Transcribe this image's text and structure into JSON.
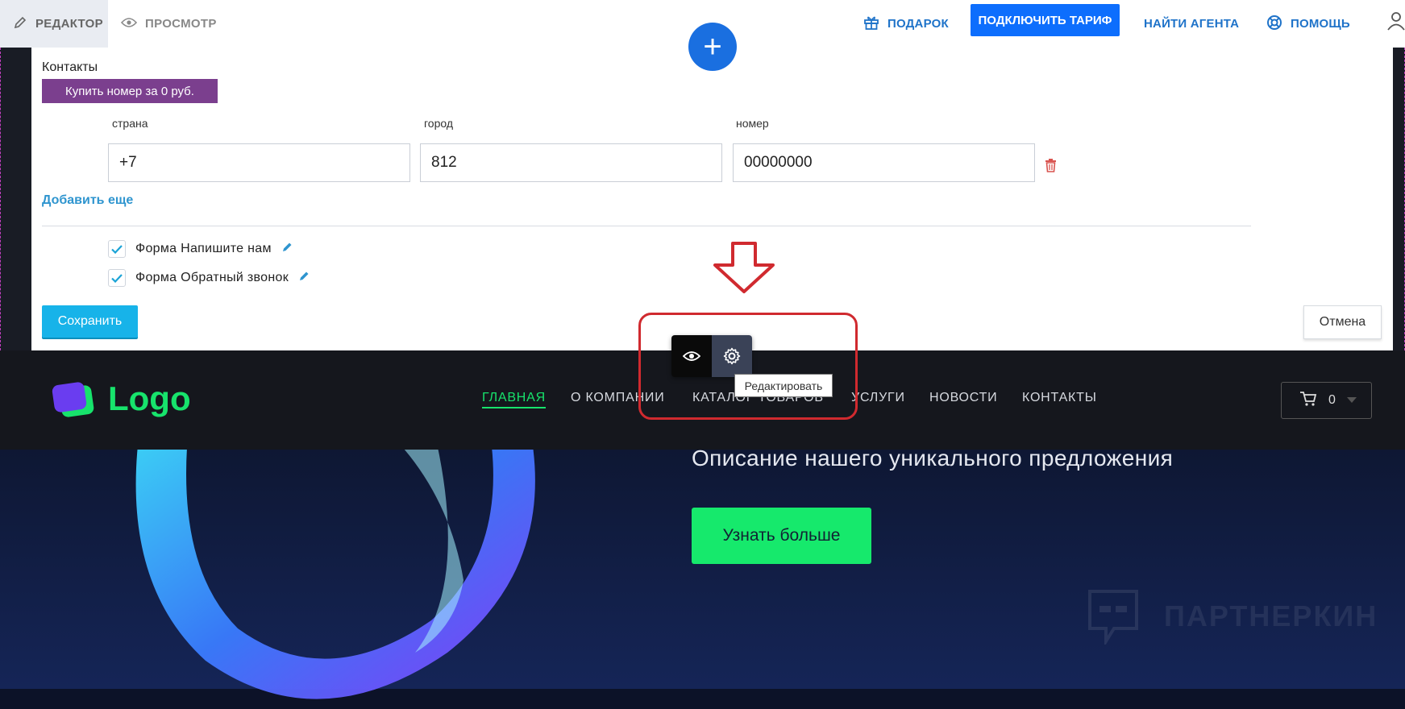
{
  "topbar": {
    "tab_editor": "РЕДАКТОР",
    "tab_preview": "ПРОСМОТР",
    "gift": "ПОДАРОК",
    "connect_tariff": "ПОДКЛЮЧИТЬ ТАРИФ",
    "find_agent": "НАЙТИ АГЕНТА",
    "help": "ПОМОЩЬ"
  },
  "contacts_panel": {
    "title": "Контакты",
    "buy_number": "Купить номер за 0 руб.",
    "labels": {
      "country": "страна",
      "city": "город",
      "number": "номер"
    },
    "values": {
      "country": "+7",
      "city": "812",
      "number": "00000000"
    },
    "add_more": "Добавить еще",
    "forms": [
      {
        "label": "Форма Напишите нам",
        "checked": true
      },
      {
        "label": "Форма Обратный звонок",
        "checked": true
      }
    ],
    "save": "Сохранить",
    "cancel": "Отмена"
  },
  "overlay": {
    "plus": "+",
    "tooltip": "Редактировать"
  },
  "site": {
    "logo": "Logo",
    "nav": [
      "ГЛАВНАЯ",
      "О КОМПАНИИ",
      "КАТАЛОГ ТОВАРОВ",
      "УСЛУГИ",
      "НОВОСТИ",
      "КОНТАКТЫ"
    ],
    "cart_count": "0",
    "hero_description": "Описание нашего уникального предложения",
    "hero_button": "Узнать больше",
    "watermark": "ПАРТНЕРКИН"
  },
  "colors": {
    "primary_blue": "#0d6efd",
    "accent_green": "#17e36c",
    "buy_purple": "#7b3f8e",
    "save_cyan": "#17b3e9",
    "highlight_red": "#d02a2f"
  },
  "icons": [
    "pencil-icon",
    "eye-icon",
    "gift-icon",
    "lifebuoy-icon",
    "user-icon",
    "trash-icon",
    "check-icon",
    "edit-pencil-icon",
    "cart-icon",
    "caret-down-icon",
    "gear-icon",
    "arrow-down-icon",
    "plus-icon"
  ]
}
